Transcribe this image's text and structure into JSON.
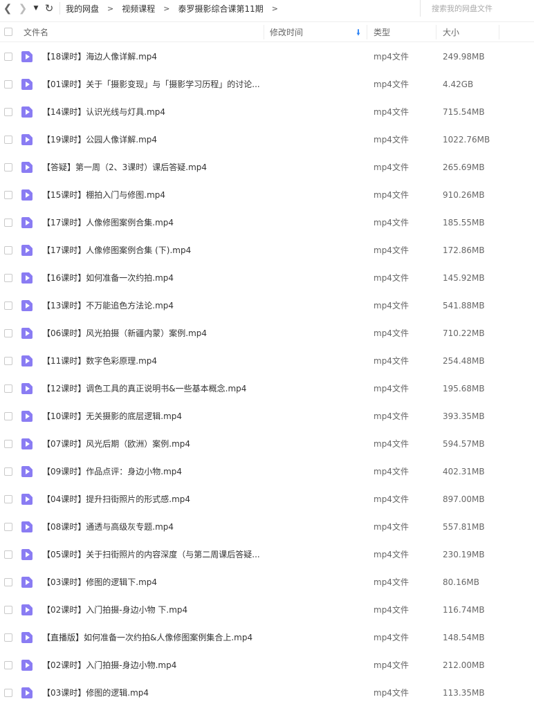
{
  "nav": {
    "breadcrumbs": [
      "我的网盘",
      "视频课程",
      "泰罗摄影综合课第11期"
    ]
  },
  "search": {
    "placeholder": "搜索我的网盘文件"
  },
  "columns": {
    "name": "文件名",
    "modified": "修改时间",
    "type": "类型",
    "size": "大小"
  },
  "files": [
    {
      "name": "【18课时】海边人像详解.mp4",
      "type": "mp4文件",
      "size": "249.98MB"
    },
    {
      "name": "【01课时】关于「摄影变现」与「摄影学习历程」的讨论...",
      "type": "mp4文件",
      "size": "4.42GB"
    },
    {
      "name": "【14课时】认识光线与灯具.mp4",
      "type": "mp4文件",
      "size": "715.54MB"
    },
    {
      "name": "【19课时】公园人像详解.mp4",
      "type": "mp4文件",
      "size": "1022.76MB"
    },
    {
      "name": "【答疑】第一周（2、3课时）课后答疑.mp4",
      "type": "mp4文件",
      "size": "265.69MB"
    },
    {
      "name": "【15课时】棚拍入门与修图.mp4",
      "type": "mp4文件",
      "size": "910.26MB"
    },
    {
      "name": "【17课时】人像修图案例合集.mp4",
      "type": "mp4文件",
      "size": "185.55MB"
    },
    {
      "name": "【17课时】人像修图案例合集 (下).mp4",
      "type": "mp4文件",
      "size": "172.86MB"
    },
    {
      "name": "【16课时】如何准备一次约拍.mp4",
      "type": "mp4文件",
      "size": "145.92MB"
    },
    {
      "name": "【13课时】不万能追色方法论.mp4",
      "type": "mp4文件",
      "size": "541.88MB"
    },
    {
      "name": "【06课时】风光拍摄（新疆内蒙）案例.mp4",
      "type": "mp4文件",
      "size": "710.22MB"
    },
    {
      "name": "【11课时】数字色彩原理.mp4",
      "type": "mp4文件",
      "size": "254.48MB"
    },
    {
      "name": "【12课时】调色工具的真正说明书&一些基本概念.mp4",
      "type": "mp4文件",
      "size": "195.68MB"
    },
    {
      "name": "【10课时】无关摄影的底层逻辑.mp4",
      "type": "mp4文件",
      "size": "393.35MB"
    },
    {
      "name": "【07课时】风光后期（欧洲）案例.mp4",
      "type": "mp4文件",
      "size": "594.57MB"
    },
    {
      "name": "【09课时】作品点评：身边小物.mp4",
      "type": "mp4文件",
      "size": "402.31MB"
    },
    {
      "name": "【04课时】提升扫街照片的形式感.mp4",
      "type": "mp4文件",
      "size": "897.00MB"
    },
    {
      "name": "【08课时】通透与高级灰专题.mp4",
      "type": "mp4文件",
      "size": "557.81MB"
    },
    {
      "name": "【05课时】关于扫街照片的内容深度（与第二周课后答疑...",
      "type": "mp4文件",
      "size": "230.19MB"
    },
    {
      "name": "【03课时】修图的逻辑下.mp4",
      "type": "mp4文件",
      "size": "80.16MB"
    },
    {
      "name": "【02课时】入门拍摄-身边小物 下.mp4",
      "type": "mp4文件",
      "size": "116.74MB"
    },
    {
      "name": "【直播版】如何准备一次约拍&人像修图案例集合上.mp4",
      "type": "mp4文件",
      "size": "148.54MB"
    },
    {
      "name": "【02课时】入门拍摄-身边小物.mp4",
      "type": "mp4文件",
      "size": "212.00MB"
    },
    {
      "name": "【03课时】修图的逻辑.mp4",
      "type": "mp4文件",
      "size": "113.35MB"
    }
  ]
}
